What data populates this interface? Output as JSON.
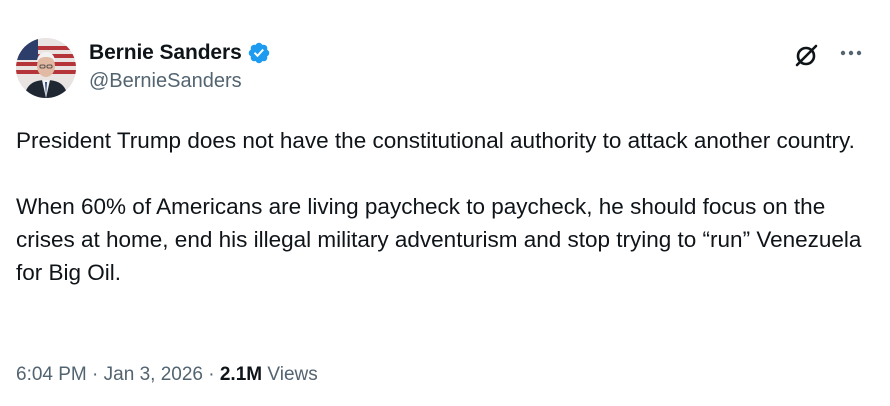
{
  "author": {
    "display_name": "Bernie Sanders",
    "handle": "@BernieSanders",
    "verified": true,
    "verified_color": "#1d9bf0"
  },
  "actions": {
    "grok_icon": "grok-icon",
    "more_icon": "more-horizontal-icon"
  },
  "tweet": {
    "paragraphs": [
      "President Trump does not have the constitutional authority to attack another country.",
      "When 60% of Americans are living paycheck to paycheck, he should focus on the crises at home, end his illegal military adventurism and stop trying to “run” Venezuela for Big Oil."
    ]
  },
  "meta": {
    "time": "6:04 PM",
    "separator": "·",
    "date": "Jan 3, 2026",
    "views_count": "2.1M",
    "views_label": "Views"
  },
  "colors": {
    "text_primary": "#0f1419",
    "text_secondary": "#536471"
  }
}
